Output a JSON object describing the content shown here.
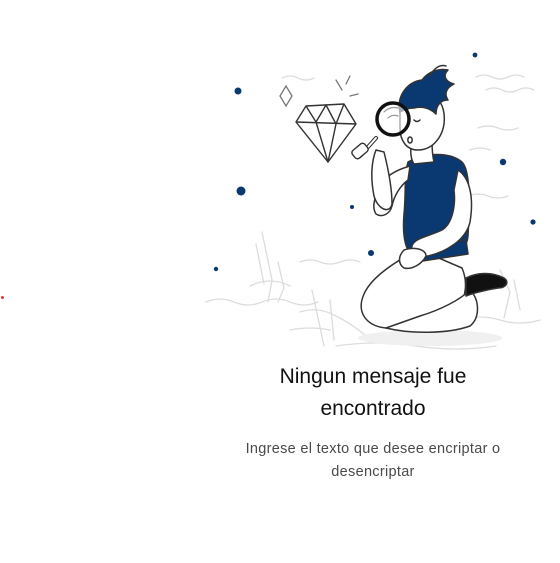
{
  "empty_state": {
    "title": "Ningun mensaje fue encontrado",
    "subtitle": "Ingrese el texto que desee encriptar o desencriptar",
    "illustration_icon": "person-with-magnifying-glass-inspecting-diamond-icon"
  },
  "colors": {
    "accent": "#0a3871",
    "red_dot": "#e53935",
    "title_text": "#111111",
    "subtitle_text": "#4a4a4a",
    "sketch_lines": "#dadada",
    "outline": "#333333"
  }
}
